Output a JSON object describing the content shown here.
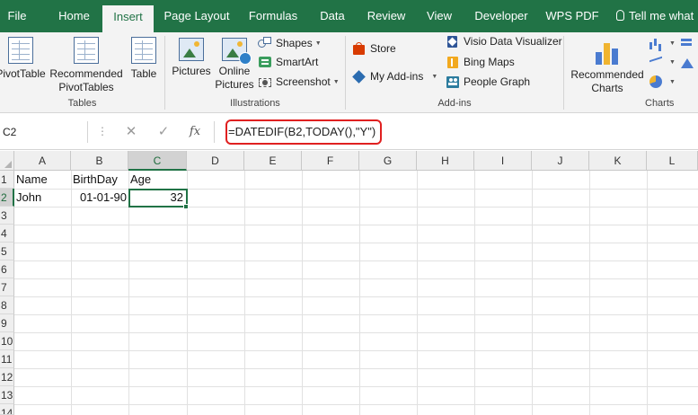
{
  "tabs": [
    "File",
    "Home",
    "Insert",
    "Page Layout",
    "Formulas",
    "Data",
    "Review",
    "View",
    "Developer",
    "WPS PDF",
    "Tell me what"
  ],
  "active_tab": "Insert",
  "ribbon": {
    "tables": {
      "pivot_table": "PivotTable",
      "recommended_line1": "Recommended",
      "recommended_line2": "PivotTables",
      "table": "Table",
      "group_label": "Tables"
    },
    "illustrations": {
      "pictures": "Pictures",
      "online_line1": "Online",
      "online_line2": "Pictures",
      "shapes": "Shapes",
      "smartart": "SmartArt",
      "screenshot": "Screenshot",
      "group_label": "Illustrations"
    },
    "addins": {
      "store": "Store",
      "my_addins": "My Add-ins",
      "visio": "Visio Data Visualizer",
      "bing_maps": "Bing Maps",
      "people_graph": "People Graph",
      "group_label": "Add-ins"
    },
    "charts": {
      "recommended_line1": "Recommended",
      "recommended_line2": "Charts",
      "group_label": "Charts"
    }
  },
  "formula_bar": {
    "name_box": "C2",
    "cancel": "✕",
    "enter": "✓",
    "fx": "fx",
    "formula": "=DATEDIF(B2,TODAY(),\"Y\")"
  },
  "sheet": {
    "columns": [
      "A",
      "B",
      "C",
      "D",
      "E",
      "F",
      "G",
      "H",
      "I",
      "J",
      "K",
      "L"
    ],
    "selected_column": "C",
    "selected_row": "2",
    "rows": [
      "1",
      "2",
      "3",
      "4",
      "5",
      "6",
      "7",
      "8",
      "9",
      "10",
      "11",
      "12",
      "13",
      "14"
    ],
    "cells": {
      "A1": "Name",
      "B1": "BirthDay",
      "C1": "Age",
      "A2": "John",
      "B2": "01-01-90",
      "C2": "32"
    }
  },
  "colors": {
    "excel_green": "#217346",
    "highlight_red": "#e02020"
  }
}
